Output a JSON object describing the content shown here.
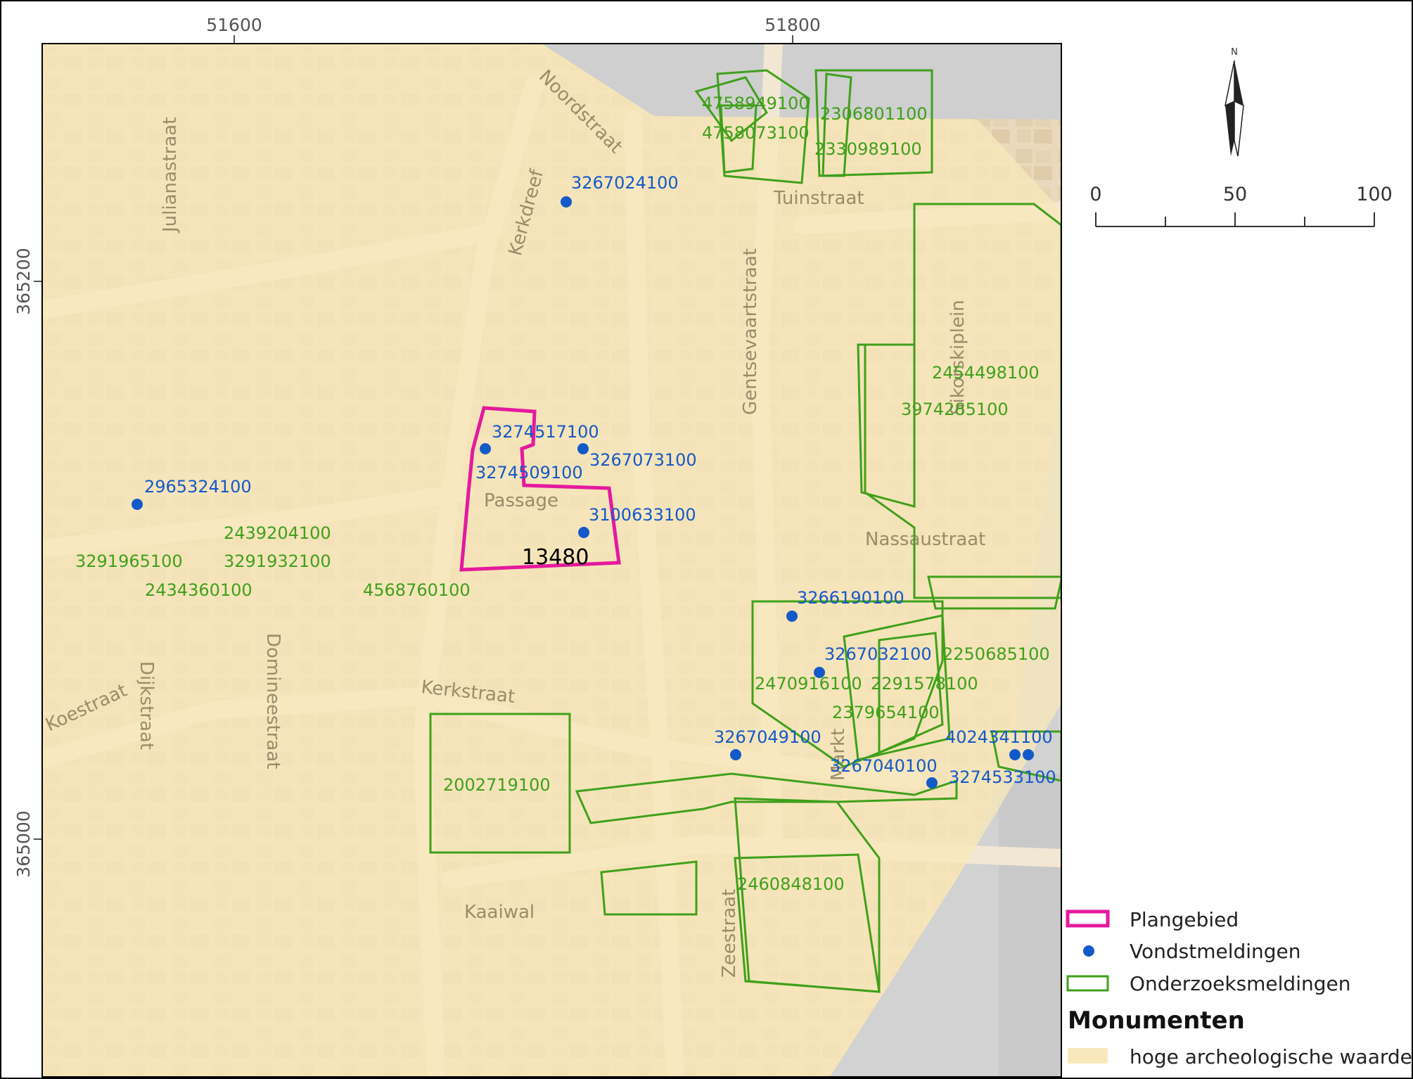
{
  "map": {
    "grid": {
      "x_labels": [
        "51600",
        "51800"
      ],
      "y_labels": [
        "365200",
        "365000"
      ]
    },
    "streets": [
      "Julianastraat",
      "Noordstraat",
      "Kerkdreef",
      "Tuinstraat",
      "Gentsevaartstraat",
      "Passage",
      "Nassaustraat",
      "Kerkstraat",
      "Koestraat",
      "Domineestraat",
      "Kaaiwal",
      "Zeestraat",
      "Markt",
      "Dijkstraat",
      "Sikorskiplein"
    ],
    "plangebied": {
      "label": "13480",
      "color": "#e5199e"
    },
    "vondstmeldingen": [
      "3267024100",
      "3274517100",
      "3274509100",
      "3267073100",
      "2965324100",
      "3100633100",
      "3266190100",
      "3267032100",
      "3267049100",
      "3267040100",
      "4024341100",
      "3274533100"
    ],
    "onderzoeksmeldingen": [
      "4758949100",
      "4758073100",
      "2306801100",
      "2330989100",
      "2454498100",
      "3974285100",
      "2439204100",
      "3291965100",
      "3291932100",
      "2434360100",
      "4568760100",
      "2250685100",
      "2470916100",
      "2291578100",
      "2379654100",
      "2002719100",
      "2460848100"
    ],
    "colors": {
      "vondst": "#1459c8",
      "onderzoek": "#3fa01a",
      "monument": "#f9e8bb",
      "base": "#ecdcc2"
    }
  },
  "north_arrow": {
    "label": "N"
  },
  "scale_bar": {
    "labels": [
      "0",
      "50",
      "100"
    ]
  },
  "legend": {
    "items": [
      "Plangebied",
      "Vondstmeldingen",
      "Onderzoeksmeldingen"
    ],
    "group_title": "Monumenten",
    "group_items": [
      "hoge archeologische waarde"
    ]
  }
}
